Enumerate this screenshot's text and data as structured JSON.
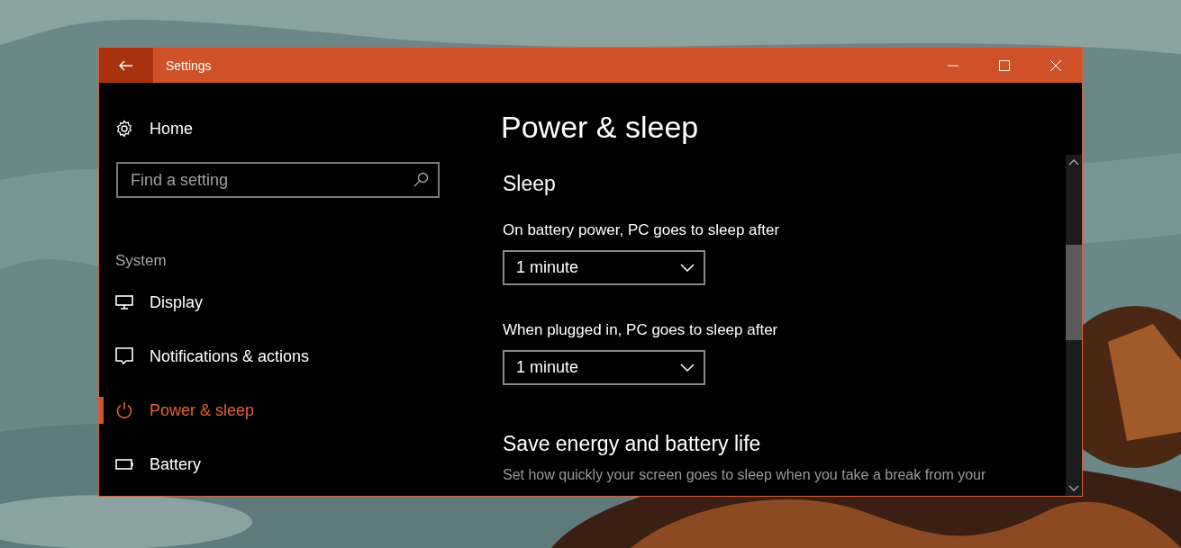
{
  "window": {
    "title": "Settings"
  },
  "sidebar": {
    "home": "Home",
    "search": {
      "placeholder": "Find a setting"
    },
    "section": "System",
    "items": [
      {
        "label": "Display",
        "kind": "display",
        "selected": false
      },
      {
        "label": "Notifications & actions",
        "kind": "notifications",
        "selected": false
      },
      {
        "label": "Power & sleep",
        "kind": "power",
        "selected": true
      },
      {
        "label": "Battery",
        "kind": "battery",
        "selected": false
      }
    ]
  },
  "content": {
    "title": "Power & sleep",
    "sections": [
      {
        "heading": "Sleep",
        "settings": [
          {
            "label": "On battery power, PC goes to sleep after",
            "value": "1 minute"
          },
          {
            "label": "When plugged in, PC goes to sleep after",
            "value": "1 minute"
          }
        ]
      },
      {
        "heading": "Save energy and battery life",
        "description": "Set how quickly your screen goes to sleep when you take a break from your"
      }
    ]
  }
}
